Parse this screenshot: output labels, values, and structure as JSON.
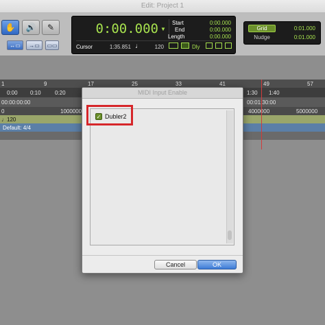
{
  "window": {
    "title": "Edit: Project 1"
  },
  "counter": {
    "main": "0:00.000",
    "start_label": "Start",
    "start_value": "0:00.000",
    "end_label": "End",
    "end_value": "0:00.000",
    "length_label": "Length",
    "length_value": "0:00.000",
    "cursor_label": "Cursor",
    "cursor_value": "1:35.851",
    "tempo_value": "120",
    "dly_label": "Dly"
  },
  "grid": {
    "grid_label": "Grid",
    "grid_value": "0:01.000",
    "nudge_label": "Nudge",
    "nudge_value": "0:01.000"
  },
  "ruler": {
    "bars": [
      "1",
      "9",
      "17",
      "25",
      "33",
      "41",
      "49",
      "57"
    ],
    "minsecs_left": [
      "0:00",
      "0:10",
      "0:20"
    ],
    "minsecs_right": [
      "1:30",
      "1:40"
    ],
    "timecode_left": "00:00:00:00",
    "timecode_right": "00:01:30:00",
    "samples_left": "0",
    "samples_mid": "1000000",
    "samples_right1": "4000000",
    "samples_right2": "5000000",
    "tempo": "120",
    "meter": "Default: 4/4"
  },
  "dialog": {
    "title": "MIDI Input Enable",
    "items": [
      {
        "label": "Dubler2",
        "checked": true
      }
    ],
    "cancel_label": "Cancel",
    "ok_label": "OK"
  },
  "colors": {
    "accent_green": "#a6e04e",
    "highlight_red": "#d6262a",
    "ok_blue": "#3d7bd6"
  }
}
